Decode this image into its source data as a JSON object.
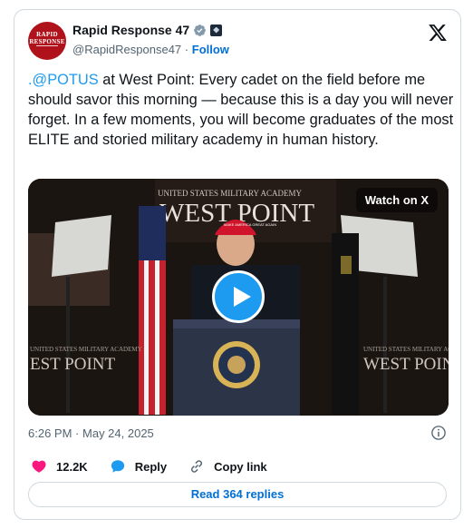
{
  "author": {
    "avatar_label": "RAPID RESPONSE",
    "display_name": "Rapid Response 47",
    "handle": "@RapidResponse47",
    "separator": "·",
    "follow_label": "Follow"
  },
  "tweet": {
    "mention": ".@POTUS",
    "text": " at West Point: Every cadet on the field before me should savor this morning — because this is a day you will never forget. In a few moments, you will become graduates of the most ELITE and storied military academy in human history."
  },
  "media": {
    "watch_label": "Watch on X",
    "banner_small": "UNITED STATES MILITARY ACADEMY",
    "banner_big": "WEST POINT",
    "side_small": "UNITED STATES MILITARY ACADEMY",
    "side_big": "WEST POINT",
    "side_big_left": "EST POINT",
    "hat_text": "MAKE AMERICA GREAT AGAIN"
  },
  "meta": {
    "time": "6:26 PM",
    "dot": "·",
    "date": "May 24, 2025"
  },
  "actions": {
    "likes": "12.2K",
    "reply": "Reply",
    "copy": "Copy link"
  },
  "read_replies": "Read 364 replies",
  "colors": {
    "accent": "#1d9bf0",
    "link": "#006fd6",
    "like": "#f91880",
    "avatar_bg": "#b0121b"
  },
  "icons": [
    "verified-badge-icon",
    "flag-badge-icon",
    "x-logo-icon",
    "play-icon",
    "info-icon",
    "heart-icon",
    "reply-bubble-icon",
    "link-icon"
  ]
}
